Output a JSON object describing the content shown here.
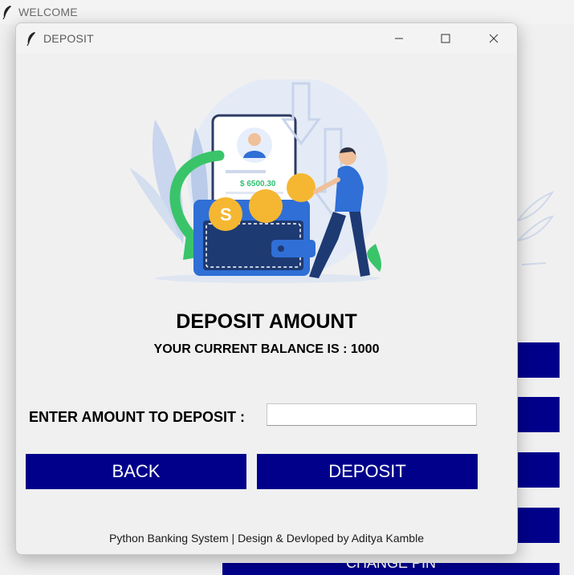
{
  "background_window": {
    "title": "WELCOME",
    "bottom_button_label": "CHANGE PIN",
    "accent_color": "#00008b"
  },
  "deposit_window": {
    "title": "DEPOSIT",
    "controls": {
      "minimize_icon": "minimize-icon",
      "maximize_icon": "maximize-icon",
      "close_icon": "close-icon"
    },
    "illustration": {
      "wallet_amount": "$ 6500.30",
      "coin_symbol": "S"
    },
    "heading": "DEPOSIT AMOUNT",
    "balance_text": "YOUR CURRENT BALANCE IS : 1000",
    "amount_label": "ENTER AMOUNT TO DEPOSIT :",
    "amount_value": "",
    "back_label": "BACK",
    "deposit_label": "DEPOSIT",
    "footer": "Python Banking System | Design & Devloped by Aditya Kamble",
    "button_color": "#00008b"
  }
}
